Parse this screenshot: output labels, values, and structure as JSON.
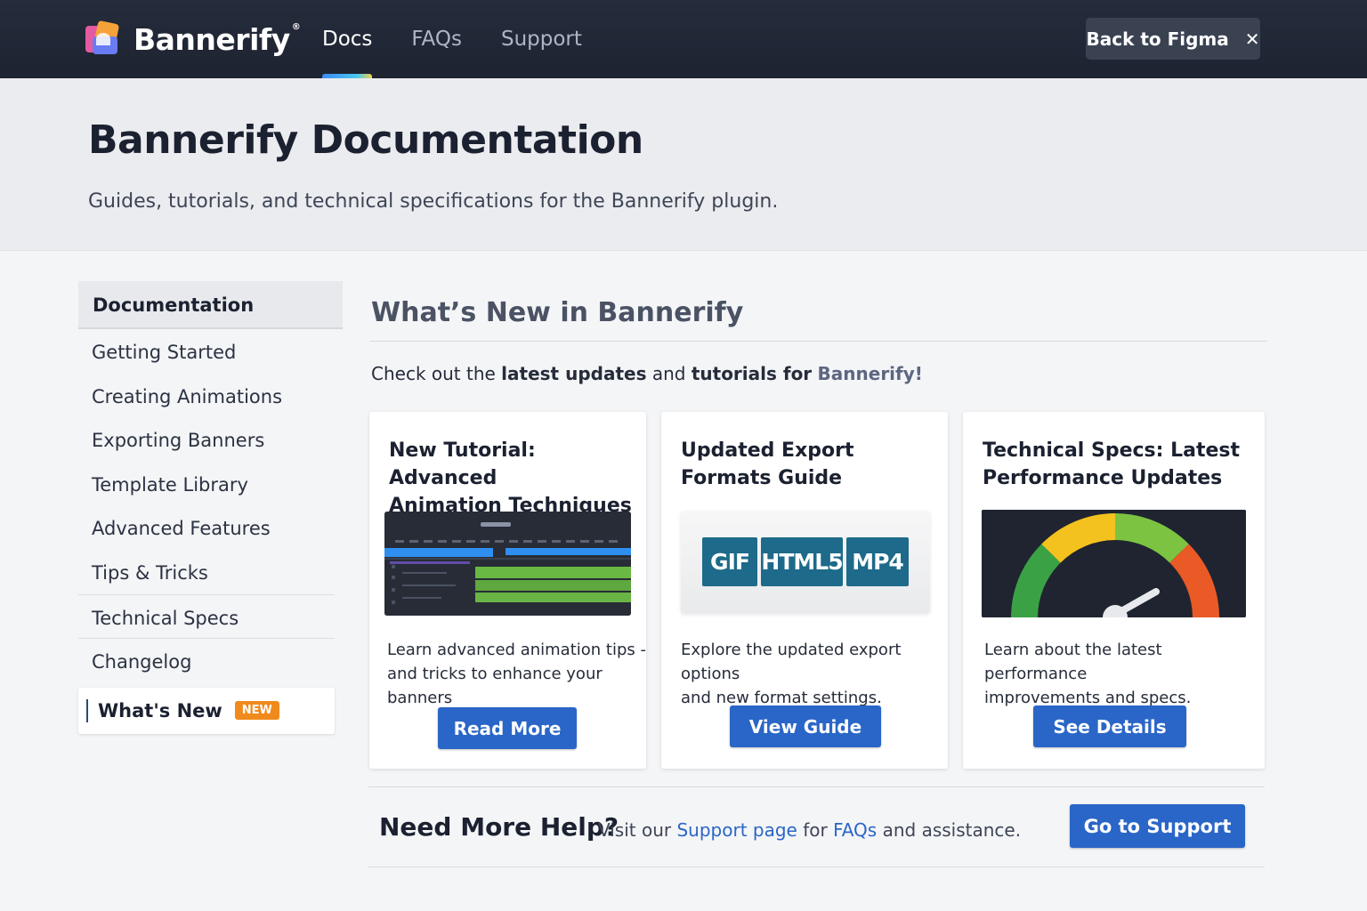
{
  "topbar": {
    "brand": "Bannerify",
    "nav": [
      "Docs",
      "FAQs",
      "Support"
    ],
    "back_label": "Back to Figma",
    "close_glyph": "✕"
  },
  "hero": {
    "title": "Bannerify Documentation",
    "subtitle": "Guides, tutorials, and technical specifications for the Bannerify plugin."
  },
  "sidebar": {
    "heading": "Documentation",
    "items": [
      "Getting Started",
      "Creating Animations",
      "Exporting Banners",
      "Template Library",
      "Advanced Features",
      "Tips & Tricks",
      "Technical Specs",
      "Changelog"
    ],
    "active": {
      "label": "What's New",
      "badge": "NEW"
    }
  },
  "main": {
    "title": "What’s New in Bannerify",
    "intro": {
      "p1": "Check out the ",
      "b1": "latest updates",
      "p2": " and ",
      "b2": "tutorials for",
      "p3": " ",
      "brand": "Bannerify!"
    },
    "cards": [
      {
        "title_l1": "New Tutorial: Advanced",
        "title_l2": "Animation Techniques",
        "desc_l1": "Learn advanced animation tips -",
        "desc_l2": "and tricks to enhance your banners",
        "button": "Read More"
      },
      {
        "title_l1": "Updated Export",
        "title_l2": "Formats Guide",
        "formats": [
          "GIF",
          "HTML5",
          "MP4"
        ],
        "desc_l1": "Explore the updated export options",
        "desc_l2": "and new format settings.",
        "button": "View Guide"
      },
      {
        "title_l1": "Technical Specs: Latest",
        "title_l2": "Performance Updates",
        "desc_l1": "Learn about the latest performance",
        "desc_l2": "improvements and specs.",
        "button": "See Details"
      }
    ]
  },
  "help": {
    "title": "Need More Help?",
    "t1": "Visit our ",
    "link1": "Support page",
    "t2": " for ",
    "link2": "FAQs",
    "t3": " and assistance.",
    "button": "Go to Support"
  },
  "colors": {
    "topbar": "#1f2533",
    "accent_blue": "#2a66c7",
    "badge_orange": "#f08a1c",
    "format_teal": "#1d6a8a"
  }
}
